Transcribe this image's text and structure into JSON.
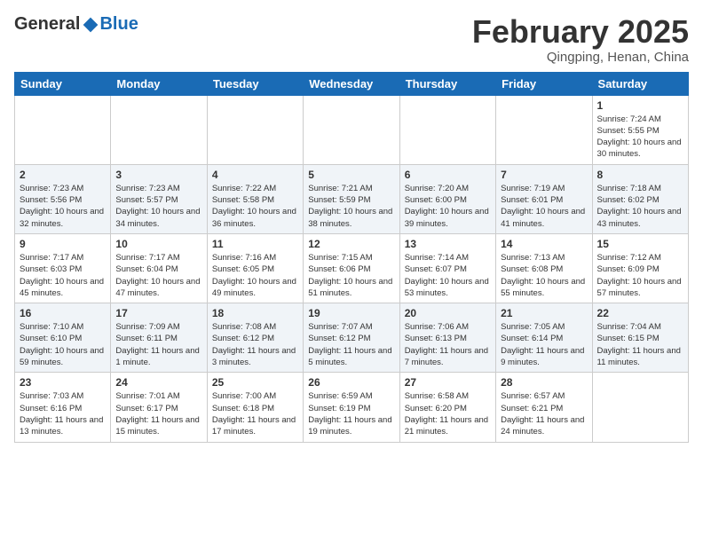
{
  "header": {
    "logo_general": "General",
    "logo_blue": "Blue",
    "month_title": "February 2025",
    "location": "Qingping, Henan, China"
  },
  "days_of_week": [
    "Sunday",
    "Monday",
    "Tuesday",
    "Wednesday",
    "Thursday",
    "Friday",
    "Saturday"
  ],
  "weeks": [
    [
      {
        "day": "",
        "info": ""
      },
      {
        "day": "",
        "info": ""
      },
      {
        "day": "",
        "info": ""
      },
      {
        "day": "",
        "info": ""
      },
      {
        "day": "",
        "info": ""
      },
      {
        "day": "",
        "info": ""
      },
      {
        "day": "1",
        "info": "Sunrise: 7:24 AM\nSunset: 5:55 PM\nDaylight: 10 hours and 30 minutes."
      }
    ],
    [
      {
        "day": "2",
        "info": "Sunrise: 7:23 AM\nSunset: 5:56 PM\nDaylight: 10 hours and 32 minutes."
      },
      {
        "day": "3",
        "info": "Sunrise: 7:23 AM\nSunset: 5:57 PM\nDaylight: 10 hours and 34 minutes."
      },
      {
        "day": "4",
        "info": "Sunrise: 7:22 AM\nSunset: 5:58 PM\nDaylight: 10 hours and 36 minutes."
      },
      {
        "day": "5",
        "info": "Sunrise: 7:21 AM\nSunset: 5:59 PM\nDaylight: 10 hours and 38 minutes."
      },
      {
        "day": "6",
        "info": "Sunrise: 7:20 AM\nSunset: 6:00 PM\nDaylight: 10 hours and 39 minutes."
      },
      {
        "day": "7",
        "info": "Sunrise: 7:19 AM\nSunset: 6:01 PM\nDaylight: 10 hours and 41 minutes."
      },
      {
        "day": "8",
        "info": "Sunrise: 7:18 AM\nSunset: 6:02 PM\nDaylight: 10 hours and 43 minutes."
      }
    ],
    [
      {
        "day": "9",
        "info": "Sunrise: 7:17 AM\nSunset: 6:03 PM\nDaylight: 10 hours and 45 minutes."
      },
      {
        "day": "10",
        "info": "Sunrise: 7:17 AM\nSunset: 6:04 PM\nDaylight: 10 hours and 47 minutes."
      },
      {
        "day": "11",
        "info": "Sunrise: 7:16 AM\nSunset: 6:05 PM\nDaylight: 10 hours and 49 minutes."
      },
      {
        "day": "12",
        "info": "Sunrise: 7:15 AM\nSunset: 6:06 PM\nDaylight: 10 hours and 51 minutes."
      },
      {
        "day": "13",
        "info": "Sunrise: 7:14 AM\nSunset: 6:07 PM\nDaylight: 10 hours and 53 minutes."
      },
      {
        "day": "14",
        "info": "Sunrise: 7:13 AM\nSunset: 6:08 PM\nDaylight: 10 hours and 55 minutes."
      },
      {
        "day": "15",
        "info": "Sunrise: 7:12 AM\nSunset: 6:09 PM\nDaylight: 10 hours and 57 minutes."
      }
    ],
    [
      {
        "day": "16",
        "info": "Sunrise: 7:10 AM\nSunset: 6:10 PM\nDaylight: 10 hours and 59 minutes."
      },
      {
        "day": "17",
        "info": "Sunrise: 7:09 AM\nSunset: 6:11 PM\nDaylight: 11 hours and 1 minute."
      },
      {
        "day": "18",
        "info": "Sunrise: 7:08 AM\nSunset: 6:12 PM\nDaylight: 11 hours and 3 minutes."
      },
      {
        "day": "19",
        "info": "Sunrise: 7:07 AM\nSunset: 6:12 PM\nDaylight: 11 hours and 5 minutes."
      },
      {
        "day": "20",
        "info": "Sunrise: 7:06 AM\nSunset: 6:13 PM\nDaylight: 11 hours and 7 minutes."
      },
      {
        "day": "21",
        "info": "Sunrise: 7:05 AM\nSunset: 6:14 PM\nDaylight: 11 hours and 9 minutes."
      },
      {
        "day": "22",
        "info": "Sunrise: 7:04 AM\nSunset: 6:15 PM\nDaylight: 11 hours and 11 minutes."
      }
    ],
    [
      {
        "day": "23",
        "info": "Sunrise: 7:03 AM\nSunset: 6:16 PM\nDaylight: 11 hours and 13 minutes."
      },
      {
        "day": "24",
        "info": "Sunrise: 7:01 AM\nSunset: 6:17 PM\nDaylight: 11 hours and 15 minutes."
      },
      {
        "day": "25",
        "info": "Sunrise: 7:00 AM\nSunset: 6:18 PM\nDaylight: 11 hours and 17 minutes."
      },
      {
        "day": "26",
        "info": "Sunrise: 6:59 AM\nSunset: 6:19 PM\nDaylight: 11 hours and 19 minutes."
      },
      {
        "day": "27",
        "info": "Sunrise: 6:58 AM\nSunset: 6:20 PM\nDaylight: 11 hours and 21 minutes."
      },
      {
        "day": "28",
        "info": "Sunrise: 6:57 AM\nSunset: 6:21 PM\nDaylight: 11 hours and 24 minutes."
      },
      {
        "day": "",
        "info": ""
      }
    ]
  ]
}
